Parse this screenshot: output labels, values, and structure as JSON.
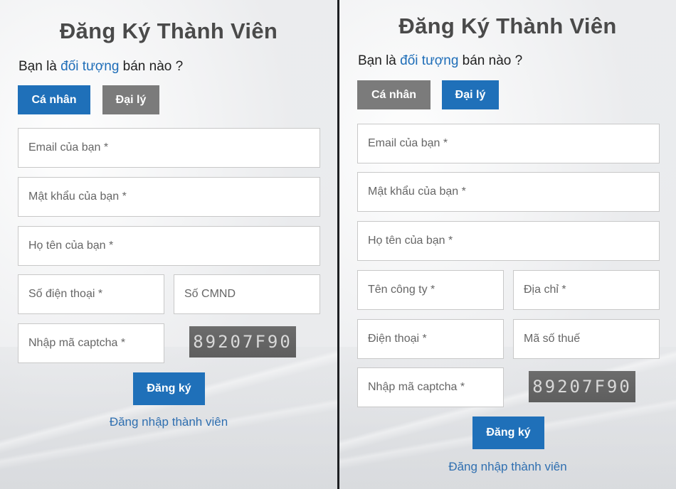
{
  "title": "Đăng Ký Thành Viên",
  "question": {
    "prefix": "Bạn là ",
    "highlight": "đối tượng",
    "suffix": " bán nào ?"
  },
  "type_buttons": {
    "personal": "Cá nhân",
    "agent": "Đại lý"
  },
  "left_form": {
    "selected": "personal",
    "email_placeholder": "Email của bạn *",
    "password_placeholder": "Mật khẩu của bạn *",
    "fullname_placeholder": "Họ tên của bạn *",
    "phone_placeholder": "Số điện thoại *",
    "id_card_placeholder": "Số CMND",
    "captcha_placeholder": "Nhập mã captcha *",
    "captcha_code": "89207F90",
    "submit_label": "Đăng ký",
    "login_link": "Đăng nhập thành viên"
  },
  "right_form": {
    "selected": "agent",
    "email_placeholder": "Email của bạn *",
    "password_placeholder": "Mật khẩu của bạn *",
    "fullname_placeholder": "Họ tên của bạn *",
    "company_placeholder": "Tên công ty *",
    "address_placeholder": "Địa chỉ *",
    "phone_placeholder": "Điện thoại *",
    "tax_code_placeholder": "Mã số thuế",
    "captcha_placeholder": "Nhập mã captcha *",
    "captcha_code": "89207F90",
    "submit_label": "Đăng ký",
    "login_link": "Đăng nhập thành viên"
  },
  "colors": {
    "accent": "#1f70b9",
    "inactive_button": "#7b7b7b",
    "link": "#2f6fb0"
  }
}
